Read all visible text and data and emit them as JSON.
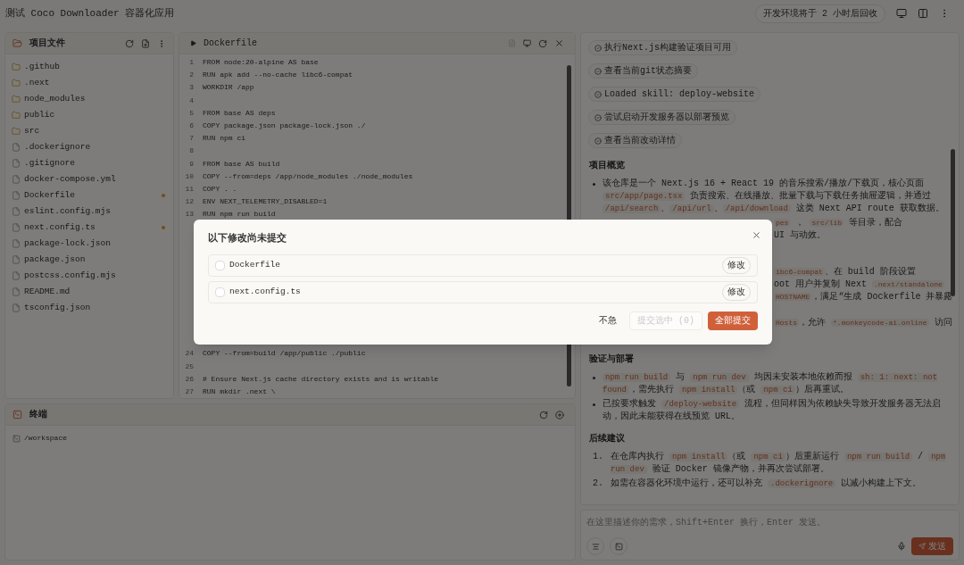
{
  "title": "测试 Coco Downloader 容器化应用",
  "env_badge": "开发环境将于 2 小时后回收",
  "file_panel": {
    "title": "项目文件",
    "items": [
      {
        "name": ".github",
        "kind": "folder",
        "modified": false
      },
      {
        "name": ".next",
        "kind": "folder",
        "modified": false
      },
      {
        "name": "node_modules",
        "kind": "folder",
        "modified": false
      },
      {
        "name": "public",
        "kind": "folder",
        "modified": false
      },
      {
        "name": "src",
        "kind": "folder",
        "modified": false
      },
      {
        "name": ".dockerignore",
        "kind": "file",
        "modified": false
      },
      {
        "name": ".gitignore",
        "kind": "file",
        "modified": false
      },
      {
        "name": "docker-compose.yml",
        "kind": "file",
        "modified": false
      },
      {
        "name": "Dockerfile",
        "kind": "file",
        "modified": true
      },
      {
        "name": "eslint.config.mjs",
        "kind": "file",
        "modified": false
      },
      {
        "name": "next.config.ts",
        "kind": "file",
        "modified": true
      },
      {
        "name": "package-lock.json",
        "kind": "file",
        "modified": false
      },
      {
        "name": "package.json",
        "kind": "file",
        "modified": false
      },
      {
        "name": "postcss.config.mjs",
        "kind": "file",
        "modified": false
      },
      {
        "name": "README.md",
        "kind": "file",
        "modified": false
      },
      {
        "name": "tsconfig.json",
        "kind": "file",
        "modified": false
      }
    ]
  },
  "editor": {
    "tab": "Dockerfile",
    "code_blocks": [
      [
        {
          "number": "1",
          "text": "FROM node:20-alpine AS base"
        },
        {
          "number": "2",
          "text": "RUN apk add --no-cache libc6-compat"
        },
        {
          "number": "3",
          "text": "WORKDIR /app"
        },
        {
          "number": "4"
        },
        {
          "number": "5",
          "text": "FROM base AS deps"
        },
        {
          "number": "6",
          "text": "COPY package.json package-lock.json ./"
        },
        {
          "number": "7",
          "text": "RUN npm ci"
        },
        {
          "number": "8"
        },
        {
          "number": "9",
          "text": "FROM base AS build"
        },
        {
          "number": "10",
          "text": "COPY --from=deps /app/node_modules ./node_modules"
        },
        {
          "number": "11",
          "text": "COPY . ."
        },
        {
          "number": "12",
          "text": "ENV NEXT_TELEMETRY_DISABLED=1"
        },
        {
          "number": "13",
          "text": "RUN npm run build"
        }
      ],
      [
        {
          "number": "24",
          "text": "COPY --from=build /app/public ./public"
        },
        {
          "number": "25"
        },
        {
          "number": "26",
          "text": "# Ensure Next.js cache directory exists and is writable"
        },
        {
          "number": "27",
          "text": "RUN mkdir .next \\"
        }
      ]
    ]
  },
  "terminal": {
    "title": "终端",
    "path": "/workspace"
  },
  "chat": {
    "chips": [
      "执行Next.js构建验证项目可用",
      "查看当前git状态摘要",
      "Loaded skill: deploy-website",
      "尝试启动开发服务器以部署预览",
      "查看当前改动详情"
    ],
    "blocks": [
      {
        "kind": "heading",
        "text": "项目概览"
      },
      {
        "kind": "bullet",
        "segments": [
          {
            "text": "该仓库是一个 Next.js 16 + React 19 的音乐搜索/播放/下载页，核心页面 "
          },
          {
            "code": "src/app/page.tsx"
          },
          {
            "text": " 负责搜索、在线播放、批量下载与下载任务抽屉逻辑，并通过 "
          },
          {
            "code": "/api/search"
          },
          {
            "text": "、"
          },
          {
            "code": "/api/url"
          },
          {
            "text": "、"
          },
          {
            "code": "/api/download"
          },
          {
            "text": " 这类 Next API route 获取数据。"
          }
        ]
      },
      {
        "kind": "covered",
        "groups": [
          [
            [
              {
                "code": "pes"
              },
              {
                "text": " ， "
              },
              {
                "code": "src/lib"
              },
              {
                "text": " 等目录，配合"
              }
            ],
            [
              {
                "text": "UI 与动效。"
              }
            ]
          ],
          [
            [
              {
                "code": "ibc6-compat"
              },
              {
                "text": "、在 build 阶段设置"
              }
            ],
            [
              {
                "text": "oot 用户并复制 Next "
              },
              {
                "code": ".next/standalone"
              }
            ],
            [
              {
                "code": "HOSTNAME"
              },
              {
                "text": "，满足“生成 Dockerfile 并暴露"
              }
            ]
          ],
          [
            [
              {
                "code": "Hosts"
              },
              {
                "text": "，允许 "
              },
              {
                "code": "*.monkeycode-ai.online"
              },
              {
                "text": " 访问"
              }
            ]
          ]
        ]
      },
      {
        "kind": "heading",
        "text": "验证与部署"
      },
      {
        "kind": "bullet",
        "segments": [
          {
            "code": "npm run build"
          },
          {
            "text": " 与 "
          },
          {
            "code": "npm run dev"
          },
          {
            "text": " 均因未安装本地依赖而报 "
          },
          {
            "code": "sh: 1: next: not found"
          },
          {
            "text": "，需先执行 "
          },
          {
            "code": "npm install"
          },
          {
            "text": "（或 "
          },
          {
            "code": "npm ci"
          },
          {
            "text": "）后再重试。"
          }
        ]
      },
      {
        "kind": "bullet",
        "segments": [
          {
            "text": "已按要求触发 "
          },
          {
            "code": "/deploy-website"
          },
          {
            "text": " 流程，但同样因为依赖缺失导致开发服务器无法启动，因此未能获得在线预览 URL。"
          }
        ]
      },
      {
        "kind": "heading",
        "text": "后续建议"
      },
      {
        "kind": "numbered",
        "marker": "1.",
        "segments": [
          {
            "text": "在仓库内执行 "
          },
          {
            "code": "npm install"
          },
          {
            "text": "（或 "
          },
          {
            "code": "npm ci"
          },
          {
            "text": "）后重新运行 "
          },
          {
            "code": "npm run build"
          },
          {
            "text": " / "
          },
          {
            "code": "npm run dev"
          },
          {
            "text": " 验证 Docker 镜像产物，并再次尝试部署。"
          }
        ]
      },
      {
        "kind": "numbered",
        "marker": "2.",
        "segments": [
          {
            "text": "如需在容器化环境中运行，还可以补充 "
          },
          {
            "code": ".dockerignore"
          },
          {
            "text": " 以减小构建上下文。"
          }
        ]
      }
    ],
    "input_placeholder": "在这里描述你的需求，Shift+Enter 换行，Enter 发送。",
    "send": "发送"
  },
  "dialog": {
    "title": "以下修改尚未提交",
    "changes": [
      {
        "name": "Dockerfile",
        "checked": false,
        "badge": "修改"
      },
      {
        "name": "next.config.ts",
        "checked": false,
        "badge": "修改"
      }
    ],
    "buttons": [
      {
        "label": "不急",
        "kind": "ghost",
        "disabled": false
      },
      {
        "label": "提交选中 (0)",
        "kind": "outline",
        "disabled": true
      },
      {
        "label": "全部提交",
        "kind": "primary",
        "disabled": false
      }
    ]
  }
}
